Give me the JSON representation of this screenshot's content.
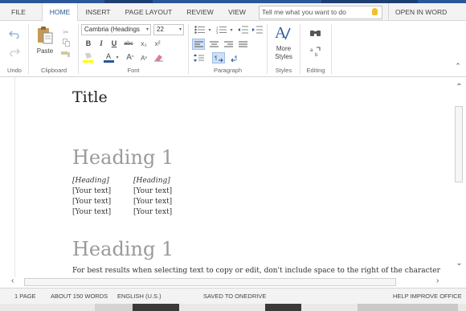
{
  "tabs": [
    "FILE",
    "HOME",
    "INSERT",
    "PAGE LAYOUT",
    "REVIEW",
    "VIEW"
  ],
  "tell_me": {
    "placeholder": "Tell me what you want to do"
  },
  "open_in_word": "OPEN IN WORD",
  "ribbon": {
    "groups": {
      "undo": "Undo",
      "clipboard": "Clipboard",
      "font": "Font",
      "paragraph": "Paragraph",
      "styles": "Styles",
      "editing": "Editing"
    },
    "paste": "Paste",
    "font_name": "Cambria (Headings",
    "font_size": "22",
    "more_styles": "More Styles",
    "bold": "B",
    "italic": "I",
    "underline": "U",
    "strike": "abc",
    "subscript": "x₂",
    "superscript": "x²",
    "grow_font": "A",
    "shrink_font": "A"
  },
  "document": {
    "title": "Title",
    "heading1": "Heading 1",
    "table": [
      [
        "[Heading]",
        "[Heading]"
      ],
      [
        "[Your text]",
        "[Your text]"
      ],
      [
        "[Your text]",
        "[Your text]"
      ],
      [
        "[Your text]",
        "[Your text]"
      ]
    ],
    "heading2": "Heading 1",
    "body": "For best results when selecting text to copy or edit, don't include space to the right of the characters"
  },
  "status": {
    "page": "1 PAGE",
    "words": "ABOUT 150 WORDS",
    "language": "ENGLISH (U.S.)",
    "saved": "SAVED TO ONEDRIVE",
    "help": "HELP IMPROVE OFFICE"
  },
  "colors": {
    "accent": "#2b579a",
    "heading_gray": "#9a9a9a",
    "font_color_bar": "#2b579a",
    "highlight_bar": "#ffff00"
  }
}
